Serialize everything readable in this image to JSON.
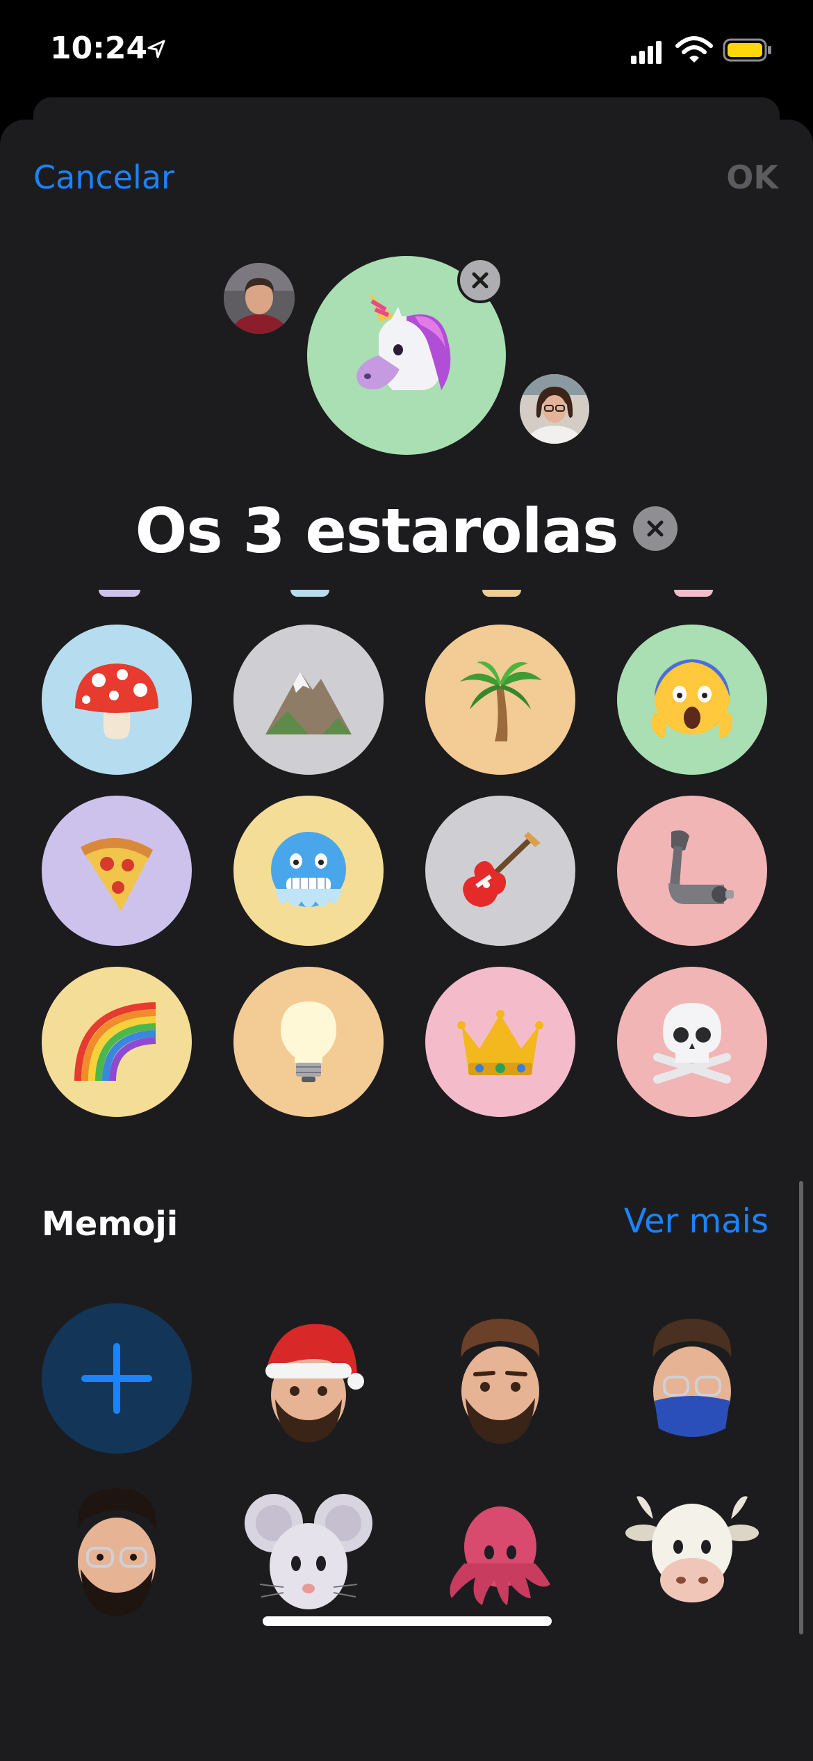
{
  "status_bar": {
    "time": "10:24"
  },
  "header": {
    "cancel_label": "Cancelar",
    "ok_label": "OK"
  },
  "group": {
    "name": "Os 3 estarolas",
    "selected_avatar": "unicorn"
  },
  "emoji_options": [
    {
      "name": "mushroom",
      "bg": "#b6dcef"
    },
    {
      "name": "mountain",
      "bg": "#cfcfd3"
    },
    {
      "name": "palm-tree",
      "bg": "#f2cc94"
    },
    {
      "name": "screaming-face",
      "bg": "#a9dfb2"
    },
    {
      "name": "pizza",
      "bg": "#cdc2ec"
    },
    {
      "name": "cold-face",
      "bg": "#f4dd97"
    },
    {
      "name": "guitar",
      "bg": "#cfcfd3"
    },
    {
      "name": "mechanical-arm",
      "bg": "#f2b5b5"
    },
    {
      "name": "rainbow",
      "bg": "#f4dd97"
    },
    {
      "name": "light-bulb",
      "bg": "#f2cc94"
    },
    {
      "name": "crown",
      "bg": "#f4bccb"
    },
    {
      "name": "skull-crossbones",
      "bg": "#f2b5b5"
    }
  ],
  "memoji": {
    "title": "Memoji",
    "see_more_label": "Ver mais",
    "items": [
      "add",
      "santa-hat-memoji",
      "bearded-memoji",
      "masked-memoji",
      "glasses-memoji",
      "mouse",
      "octopus",
      "cow"
    ]
  },
  "colors": {
    "accent": "#1a84ff",
    "sheet_bg": "#1c1c1e"
  }
}
